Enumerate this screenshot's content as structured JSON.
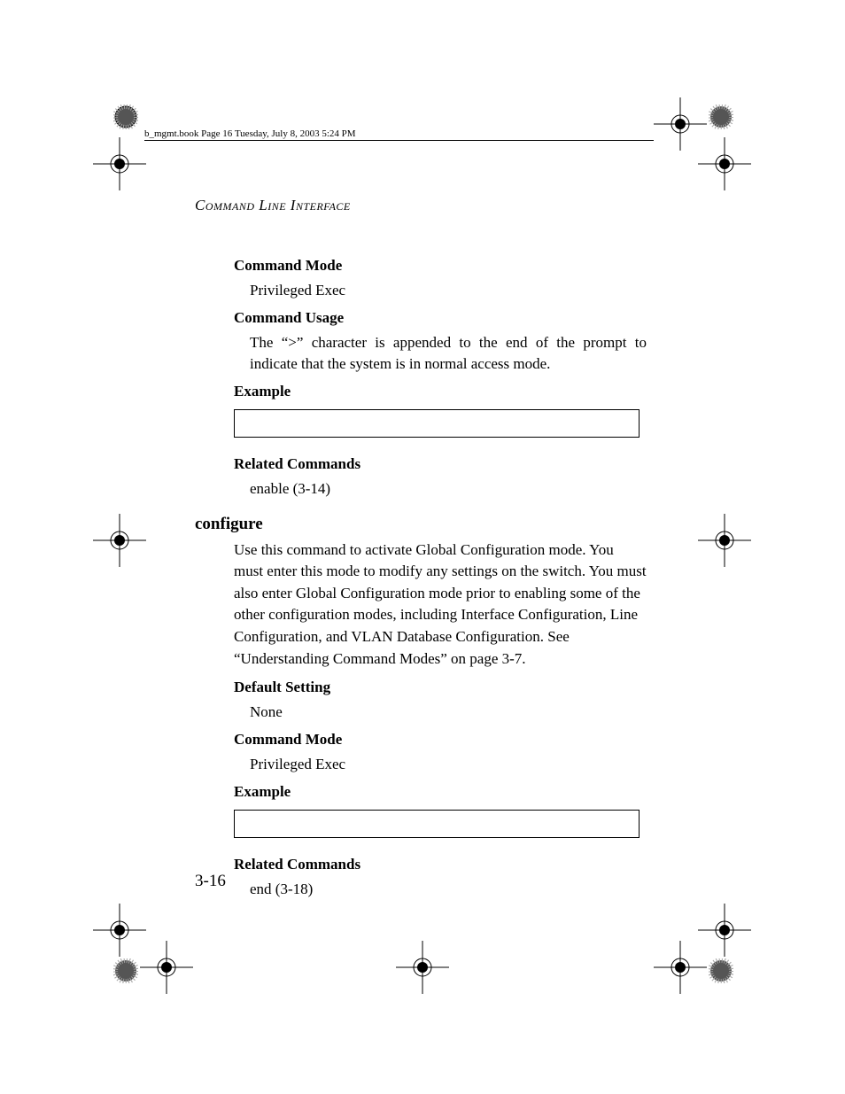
{
  "header_line": "b_mgmt.book  Page 16  Tuesday, July 8, 2003  5:24 PM",
  "running_head": "Command Line Interface",
  "sec1": {
    "h_mode": "Command Mode",
    "mode_text": "Privileged Exec",
    "h_usage": "Command Usage",
    "usage_text": "The “>” character is appended to the end of the prompt to indicate that the system is in normal access mode.",
    "h_example": "Example",
    "h_related": "Related Commands",
    "related_text": "enable (3-14)"
  },
  "command_title": "configure",
  "sec2": {
    "intro": "Use this command to activate Global Configuration mode. You must enter this mode to modify any settings on the switch. You must also enter Global Configuration mode prior to enabling some of the other configuration modes, including Interface Configuration, Line Configuration, and VLAN Database Configuration. See “Understanding Command Modes” on page 3-7.",
    "h_default": "Default Setting",
    "default_text": "None",
    "h_mode": "Command Mode",
    "mode_text": "Privileged Exec",
    "h_example": "Example",
    "h_related": "Related Commands",
    "related_text": "end (3-18)"
  },
  "page_number": "3-16"
}
